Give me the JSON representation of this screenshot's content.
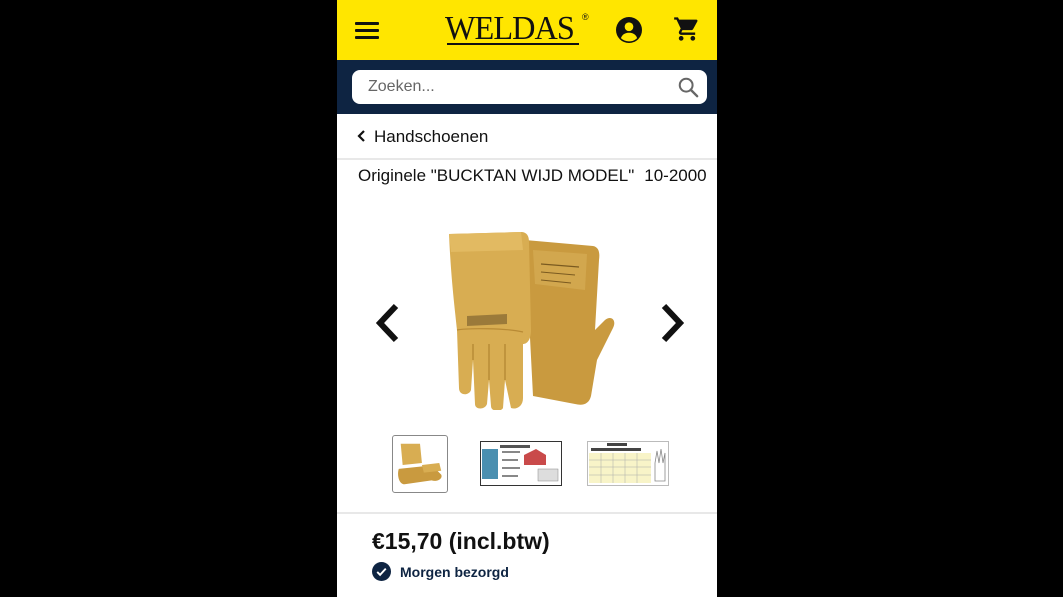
{
  "header": {
    "brand": "WELDAS",
    "brand_mark": "®",
    "menu_icon": "hamburger-menu-icon",
    "account_icon": "account-circle-icon",
    "cart_icon": "shopping-cart-icon",
    "background_color": "#ffe600"
  },
  "search": {
    "placeholder": "Zoeken...",
    "value": "",
    "icon": "search-icon",
    "bar_color": "#0e2442"
  },
  "breadcrumb": {
    "label": "Handschoenen",
    "icon": "chevron-left-icon"
  },
  "product": {
    "title": "Originele \"BUCKTAN WIJD MODEL\"",
    "sku": "10-2000",
    "image_alt": "leather-welding-gloves",
    "gallery": {
      "prev_icon": "chevron-left-icon",
      "next_icon": "chevron-right-icon",
      "thumbnails": [
        "gloves-thumbnail",
        "product-label-thumbnail",
        "size-chart-thumbnail"
      ],
      "selected_thumbnail": 1
    },
    "price": "€15,70 (incl.btw)",
    "delivery": "Morgen bezorgd",
    "delivery_icon": "check-circle-icon"
  }
}
